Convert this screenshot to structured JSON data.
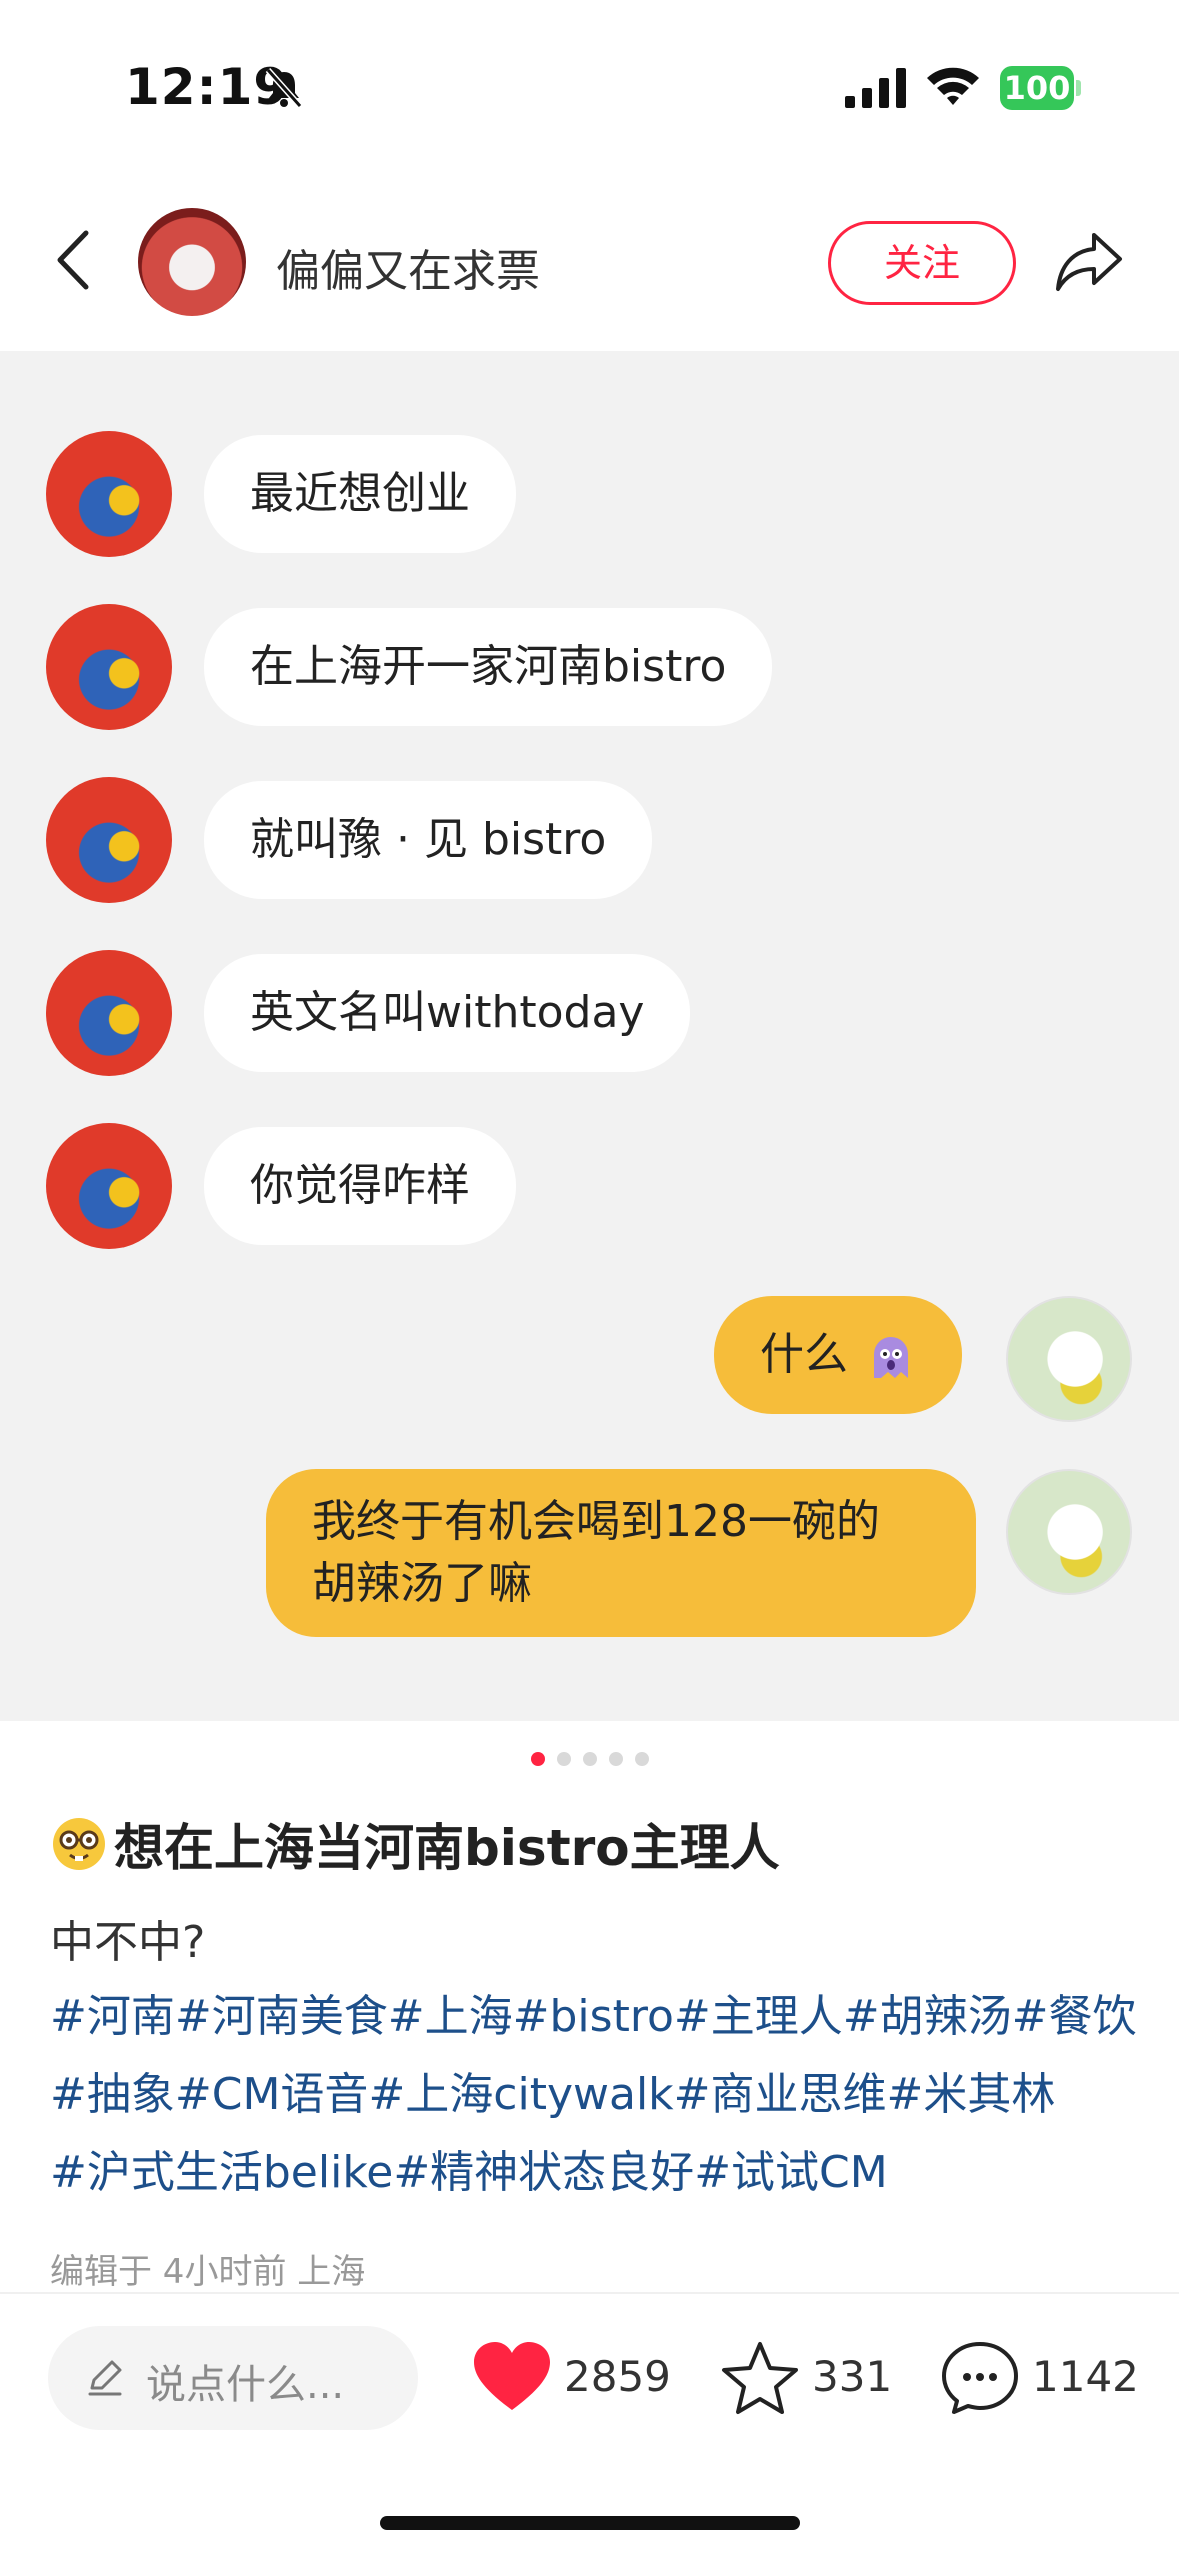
{
  "status_bar": {
    "time": "12:19",
    "battery": "100",
    "icons": [
      "bell-slash-icon",
      "signal-icon",
      "wifi-icon",
      "battery-icon"
    ]
  },
  "header": {
    "author_name": "偏偏又在求票",
    "follow_label": "关注",
    "icons": [
      "back-icon",
      "share-icon"
    ]
  },
  "chat": {
    "messages": [
      {
        "side": "left",
        "text": "最近想创业"
      },
      {
        "side": "left",
        "text": "在上海开一家河南bistro"
      },
      {
        "side": "left",
        "text": "就叫豫 · 见 bistro"
      },
      {
        "side": "left",
        "text": "英文名叫withtoday"
      },
      {
        "side": "left",
        "text": "你觉得咋样"
      },
      {
        "side": "right",
        "text": "什么"
      },
      {
        "side": "right",
        "line1": "我终于有机会喝到128一碗的",
        "line2": "胡辣汤了嘛"
      }
    ]
  },
  "carousel": {
    "total": 5,
    "active": 1
  },
  "post": {
    "title": "想在上海当河南bistro主理人",
    "body": "中不中?",
    "tags": [
      "#河南",
      "#河南美食",
      "#上海",
      "#bistro",
      "#主理人",
      "#胡辣汤",
      "#餐饮",
      "#抽象",
      "#CM语音",
      "#上海citywalk",
      "#商业思维",
      "#米其林",
      "#沪式生活belike",
      "#精神状态良好",
      "#试试CM"
    ],
    "meta": "编辑于 4小时前 上海"
  },
  "actions": {
    "comment_placeholder": "说点什么...",
    "likes": "2859",
    "favorites": "331",
    "comments": "1142"
  },
  "colors": {
    "accent_red": "#ff2442",
    "bubble_yellow": "#f6bd3a",
    "tag_blue": "#1d4f8a",
    "chat_bg": "#f2f2f2"
  }
}
